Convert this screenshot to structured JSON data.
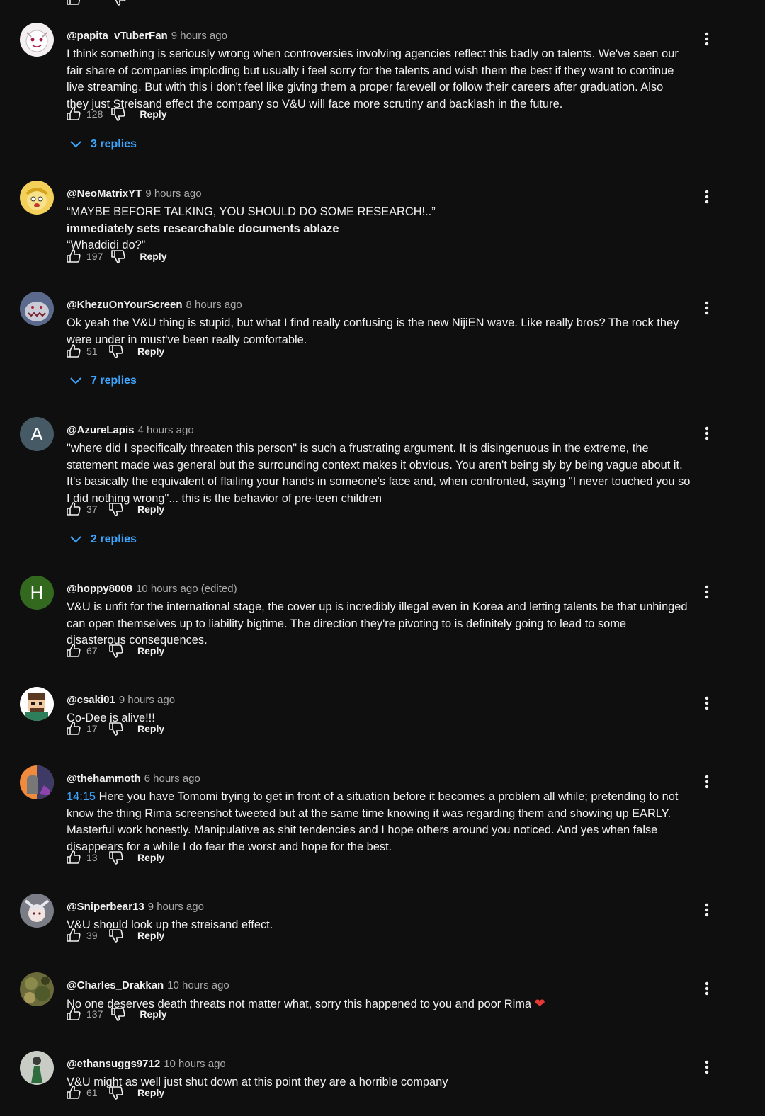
{
  "accent_link_color": "#3ea6ff",
  "background_color": "#0f0f0f",
  "comments": [
    {
      "author": "@papita_vTuberFan",
      "time": "9 hours ago",
      "lines": [
        [
          {
            "t": "I think something is seriously wrong when controversies involving agencies reflect this badly on talents. We've seen our"
          }
        ],
        [
          {
            "t": "fair share of companies imploding but usually i feel sorry for the talents and wish them the best if they want to continue"
          }
        ],
        [
          {
            "t": "live streaming. But with this i don't feel like giving them a proper farewell or follow their careers after graduation. Also"
          }
        ],
        [
          {
            "t": "they just Streisand effect the company so V&U will face more scrutiny and backlash in the future."
          }
        ]
      ],
      "likes": "128",
      "reply_label": "Reply",
      "replies_label": "3 replies",
      "avatar": {
        "kind": "image",
        "icon": "white-mascot-avatar",
        "bg": "#f4f0f2"
      }
    },
    {
      "author": "@NeoMatrixYT",
      "time": "9 hours ago",
      "lines": [
        [
          {
            "t": "“MAYBE BEFORE TALKING, YOU SHOULD DO SOME RESEARCH!..”"
          }
        ],
        [
          {
            "t": " immediately sets researchable documents ablaze",
            "s": "bold"
          }
        ],
        [
          {
            "t": "“Whaddidi do?”"
          }
        ]
      ],
      "likes": "197",
      "reply_label": "Reply",
      "replies_label": "",
      "avatar": {
        "kind": "image",
        "icon": "yellow-cartoon-avatar",
        "bg": "#f2d05a"
      }
    },
    {
      "author": "@KhezuOnYourScreen",
      "time": "8 hours ago",
      "lines": [
        [
          {
            "t": "Ok yeah the V&U thing is stupid, but what I find really confusing is the new NijiEN wave. Like really bros? The rock they"
          }
        ],
        [
          {
            "t": "were under in must've been really comfortable."
          }
        ]
      ],
      "likes": "51",
      "reply_label": "Reply",
      "replies_label": "7 replies",
      "avatar": {
        "kind": "image",
        "icon": "monster-avatar",
        "bg": "#5b6a8c"
      }
    },
    {
      "author": "@AzureLapis",
      "time": "4 hours ago",
      "lines": [
        [
          {
            "t": "\"where did I specifically threaten this person\" is such a frustrating argument.  It is disingenuous in the extreme, the"
          }
        ],
        [
          {
            "t": "statement made was general but the surrounding context makes it obvious.  You aren't being sly by being vague about it."
          }
        ],
        [
          {
            "t": "It's basically the equivalent of flailing your hands in someone's face and, when confronted, saying \"I never touched you so"
          }
        ],
        [
          {
            "t": "I did nothing wrong\"... this is the behavior of pre-teen children"
          }
        ]
      ],
      "likes": "37",
      "reply_label": "Reply",
      "replies_label": "2 replies",
      "avatar": {
        "kind": "letter",
        "letter": "A",
        "bg": "#455a64"
      }
    },
    {
      "author": "@hoppy8008",
      "time": "10 hours ago (edited)",
      "lines": [
        [
          {
            "t": "V&U is unfit for the international stage, the cover up is incredibly illegal even in Korea and letting talents be that unhinged"
          }
        ],
        [
          {
            "t": "can open themselves up to liability bigtime.  The direction they're pivoting to is definitely going to lead to some"
          }
        ],
        [
          {
            "t": "disasterous consequences."
          }
        ]
      ],
      "likes": "67",
      "reply_label": "Reply",
      "replies_label": "",
      "avatar": {
        "kind": "letter",
        "letter": "H",
        "bg": "#33691e"
      }
    },
    {
      "author": "@csaki01",
      "time": "9 hours ago",
      "lines": [
        [
          {
            "t": "Co-Dee is alive!!!"
          }
        ]
      ],
      "likes": "17",
      "reply_label": "Reply",
      "replies_label": "",
      "avatar": {
        "kind": "image",
        "icon": "pixel-art-avatar",
        "bg": "#ffffff"
      }
    },
    {
      "author": "@thehammoth",
      "time": "6 hours ago",
      "lines": [
        [
          {
            "t": "14:15",
            "s": "ts"
          },
          {
            "t": " Here you have Tomomi trying to get in front of a situation before it becomes a problem all while; pretending to not"
          }
        ],
        [
          {
            "t": "know the thing Rima screenshot tweeted but at the same time knowing it was regarding them and showing up EARLY."
          }
        ],
        [
          {
            "t": "Masterful work honestly. Manipulative as shit tendencies and I hope others around you noticed. And yes when false"
          }
        ],
        [
          {
            "t": "disappears for a while I do fear the worst and hope for the best."
          }
        ]
      ],
      "likes": "13",
      "reply_label": "Reply",
      "replies_label": "",
      "avatar": {
        "kind": "image",
        "icon": "tombstone-avatar",
        "bg": "#f08a3c"
      }
    },
    {
      "author": "@Sniperbear13",
      "time": "9 hours ago",
      "lines": [
        [
          {
            "t": "V&U should look up the streisand effect."
          }
        ]
      ],
      "likes": "39",
      "reply_label": "Reply",
      "replies_label": "",
      "avatar": {
        "kind": "image",
        "icon": "anime-character-avatar",
        "bg": "#7b7d86"
      }
    },
    {
      "author": "@Charles_Drakkan",
      "time": "10 hours ago",
      "lines": [
        [
          {
            "t": "No one deserves death threats not matter what, sorry this happened to you and poor Rima "
          },
          {
            "t": "❤",
            "s": "heart"
          }
        ]
      ],
      "likes": "137",
      "reply_label": "Reply",
      "replies_label": "",
      "avatar": {
        "kind": "image",
        "icon": "camouflage-avatar",
        "bg": "#6b6a3a"
      }
    },
    {
      "author": "@ethansuggs9712",
      "time": "10 hours ago",
      "lines": [
        [
          {
            "t": "V&U might as well just shut down at this point they are a horrible company"
          }
        ]
      ],
      "likes": "61",
      "reply_label": "Reply",
      "replies_label": "",
      "avatar": {
        "kind": "image",
        "icon": "figure-in-green-avatar",
        "bg": "#c8ccc4"
      }
    }
  ]
}
